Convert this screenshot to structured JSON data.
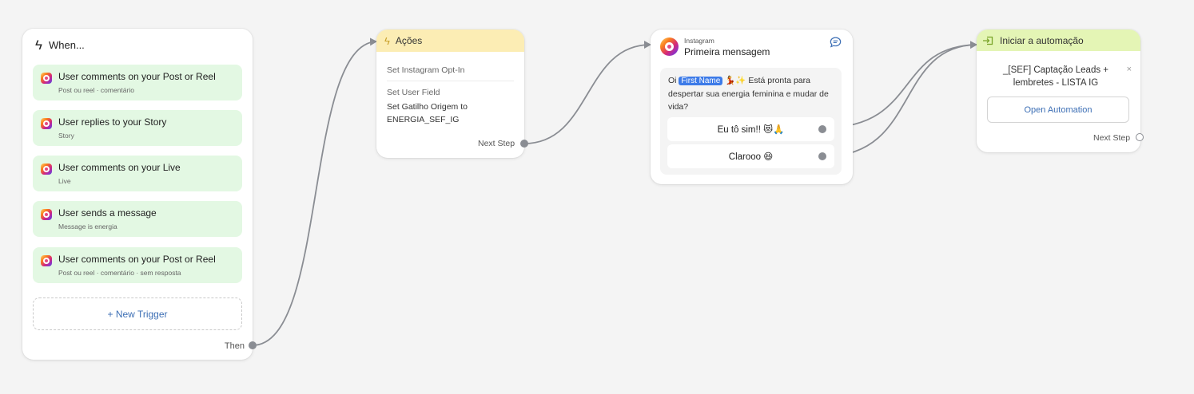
{
  "trigger": {
    "title": "When...",
    "items": [
      {
        "title": "User comments on your Post or Reel",
        "subtitle": "Post ou reel · comentário"
      },
      {
        "title": "User replies to your Story",
        "subtitle": "Story"
      },
      {
        "title": "User comments on your Live",
        "subtitle": "Live"
      },
      {
        "title": "User sends a message",
        "subtitle": "Message is energia"
      },
      {
        "title": "User comments on your Post or Reel",
        "subtitle": "Post ou reel · comentário · sem resposta"
      }
    ],
    "new_trigger_label": "+ New Trigger",
    "then_label": "Then"
  },
  "acoes": {
    "title": "Ações",
    "action1": "Set Instagram Opt-In",
    "action2_label": "Set User Field",
    "action2_value": "Set Gatilho Origem to ENERGIA_SEF_IG",
    "next_step_label": "Next Step"
  },
  "instagram": {
    "platform": "Instagram",
    "title": "Primeira mensagem",
    "message_prefix": "Oi",
    "message_tag": "First Name",
    "message_emoji": "💃✨",
    "message_body": "Está pronta para despertar sua energia feminina e mudar de vida?",
    "buttons": [
      "Eu tô sim!! 😻🙏",
      "Clarooo 😆"
    ]
  },
  "iniciar": {
    "title": "Iniciar a automação",
    "automation_name": "_[SEF] Captação Leads + lembretes - LISTA IG",
    "close_glyph": "×",
    "open_button_label": "Open Automation",
    "next_step_label": "Next Step"
  },
  "colors": {
    "canvas_bg": "#f4f4f4",
    "trigger_item_bg": "#e3f8e3",
    "acoes_header": "#fcedb4",
    "iniciar_header": "#e4f5b5",
    "link_blue": "#3d6fb5",
    "tag_blue": "#3d7be8",
    "connector": "#8a8d93"
  },
  "icons": {
    "trigger": "lightning-bolt-icon",
    "acoes": "lightning-bolt-icon",
    "instagram": "instagram-icon",
    "chat": "chat-bubble-icon",
    "iniciar": "enter-arrow-icon",
    "close": "close-icon"
  }
}
